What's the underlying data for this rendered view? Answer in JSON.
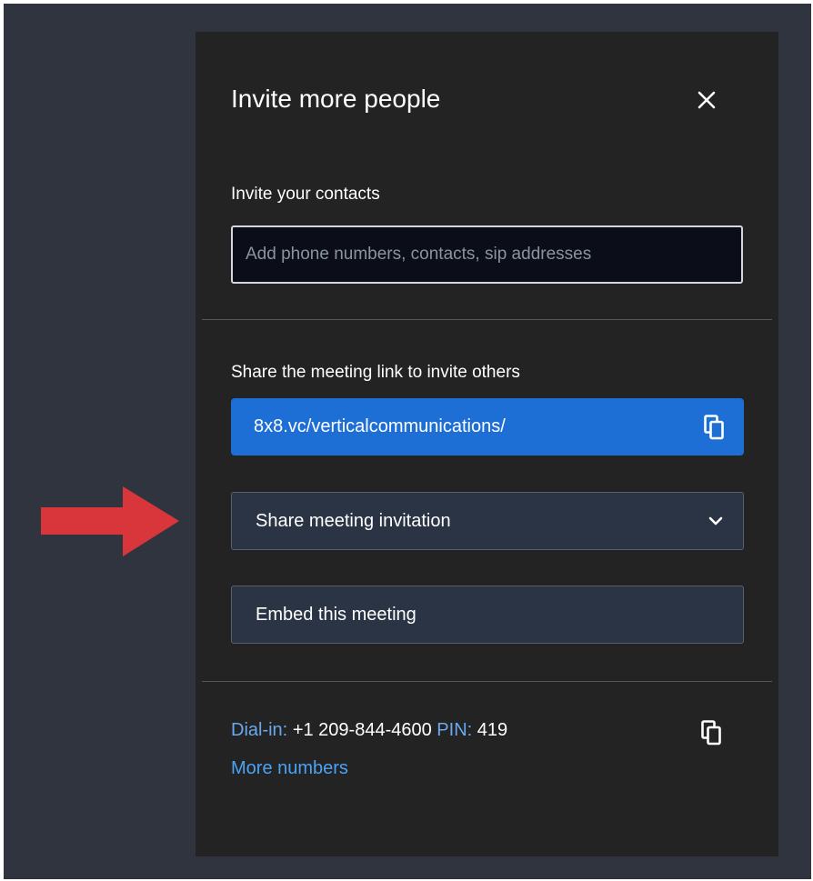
{
  "dialog": {
    "title": "Invite more people",
    "invite_label": "Invite your contacts",
    "invite_placeholder": "Add phone numbers, contacts, sip addresses",
    "share_label": "Share the meeting link to invite others",
    "meeting_link": "8x8.vc/verticalcommunications/",
    "share_invitation_button": "Share meeting invitation",
    "embed_button": "Embed this meeting",
    "dial_in_label": "Dial-in:",
    "dial_in_number": "+1 209-844-4600",
    "pin_label": "PIN:",
    "pin_value": "419",
    "more_numbers_link": "More numbers"
  },
  "colors": {
    "backdrop": "#2f343f",
    "dialog_bg": "#232324",
    "accent_blue": "#1d6fd6",
    "link_blue": "#4aa3f5",
    "button_bg": "#2b3444",
    "arrow_red": "#d9363c"
  },
  "icons": {
    "close": "close-icon",
    "copy": "copy-icon",
    "chevron": "chevron-down-icon",
    "annotation": "red-arrow-annotation"
  }
}
